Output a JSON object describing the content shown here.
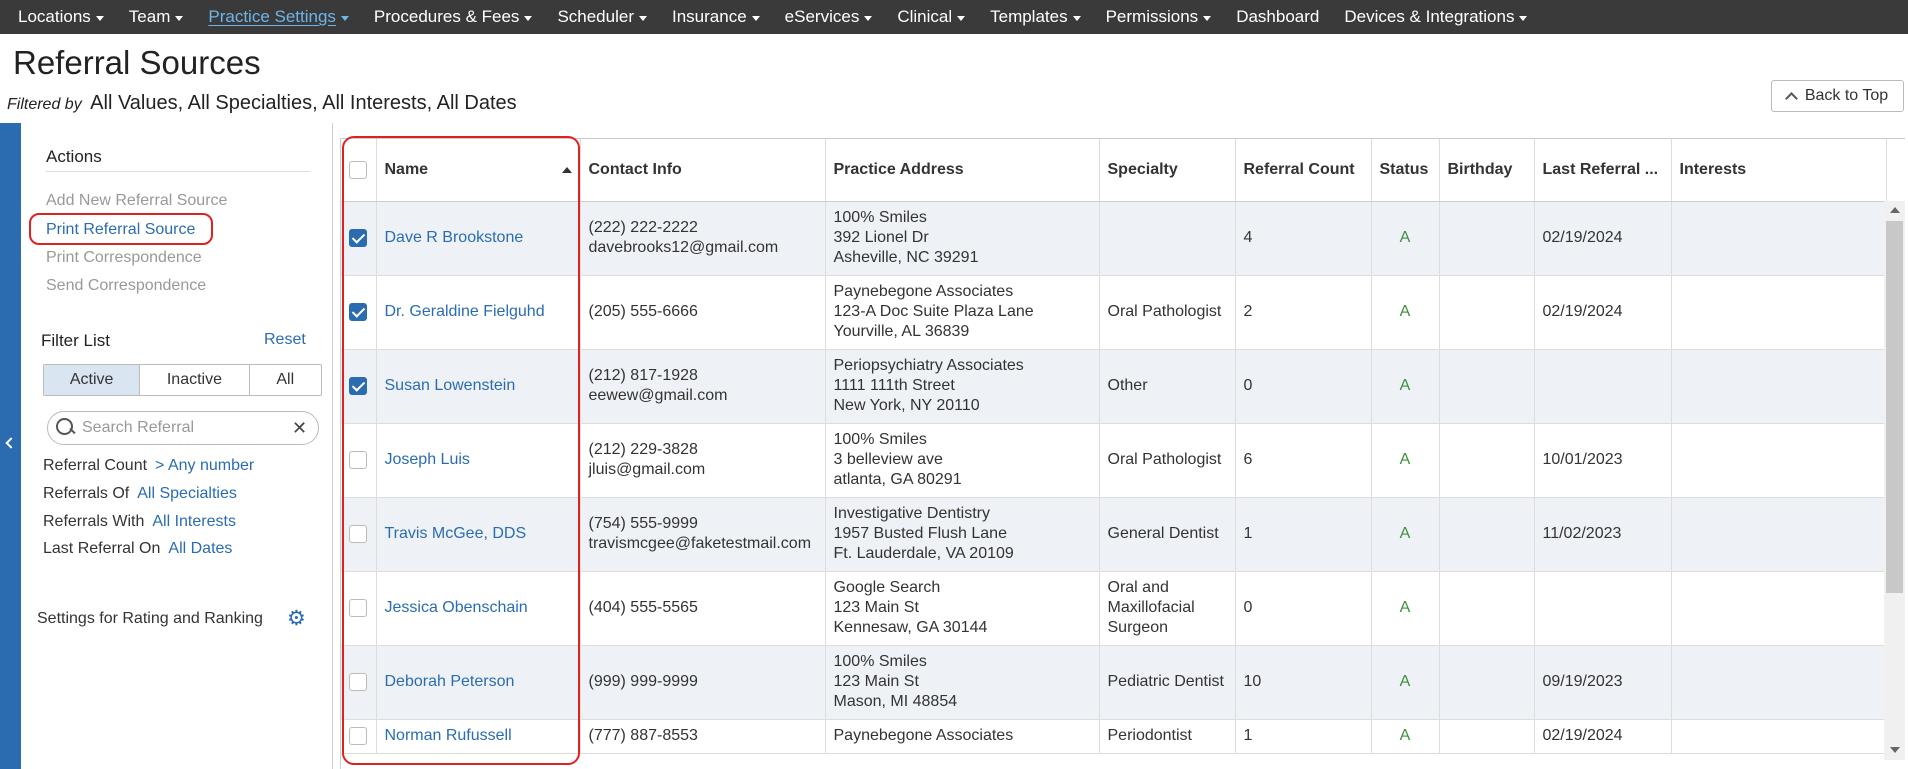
{
  "nav": {
    "items": [
      {
        "label": "Locations",
        "caret": true,
        "active": false
      },
      {
        "label": "Team",
        "caret": true,
        "active": false
      },
      {
        "label": "Practice Settings",
        "caret": true,
        "active": true
      },
      {
        "label": "Procedures & Fees",
        "caret": true,
        "active": false
      },
      {
        "label": "Scheduler",
        "caret": true,
        "active": false
      },
      {
        "label": "Insurance",
        "caret": true,
        "active": false
      },
      {
        "label": "eServices",
        "caret": true,
        "active": false
      },
      {
        "label": "Clinical",
        "caret": true,
        "active": false
      },
      {
        "label": "Templates",
        "caret": true,
        "active": false
      },
      {
        "label": "Permissions",
        "caret": true,
        "active": false
      },
      {
        "label": "Dashboard",
        "caret": false,
        "active": false
      },
      {
        "label": "Devices & Integrations",
        "caret": true,
        "active": false
      }
    ]
  },
  "header": {
    "title": "Referral Sources",
    "filtered_by_label": "Filtered by",
    "filtered_values": "All Values, All Specialties, All Interests, All Dates",
    "back_to_top": "Back to Top"
  },
  "sidebar": {
    "actions_title": "Actions",
    "actions": [
      {
        "label": "Add New Referral Source",
        "enabled": false
      },
      {
        "label": "Print Referral Source",
        "enabled": true
      },
      {
        "label": "Print Correspondence",
        "enabled": false
      },
      {
        "label": "Send Correspondence",
        "enabled": false
      }
    ],
    "filter_title": "Filter List",
    "reset": "Reset",
    "segments": [
      "Active",
      "Inactive",
      "All"
    ],
    "selected_segment": "Active",
    "search_placeholder": "Search Referral",
    "filters": [
      {
        "label": "Referral Count",
        "value": "> Any number"
      },
      {
        "label": "Referrals Of",
        "value": "All Specialties"
      },
      {
        "label": "Referrals With",
        "value": "All Interests"
      },
      {
        "label": "Last Referral On",
        "value": "All Dates"
      }
    ],
    "settings_label": "Settings for Rating and Ranking"
  },
  "table": {
    "columns": [
      "Name",
      "Contact Info",
      "Practice Address",
      "Specialty",
      "Referral Count",
      "Status",
      "Birthday",
      "Last Referral ...",
      "Interests"
    ],
    "rows": [
      {
        "checked": true,
        "name": "Dave R Brookstone",
        "contact": [
          "(222) 222-2222",
          "davebrooks12@gmail.com"
        ],
        "address": [
          "100% Smiles",
          "392 Lionel Dr",
          "Asheville, NC 39291"
        ],
        "specialty": [
          ""
        ],
        "count": "4",
        "status": "A",
        "birthday": "",
        "last_referral": "02/19/2024",
        "interests": ""
      },
      {
        "checked": true,
        "name": "Dr. Geraldine Fielguhd",
        "contact": [
          "(205) 555-6666"
        ],
        "address": [
          "Paynebegone Associates",
          "123-A Doc Suite Plaza Lane",
          "Yourville, AL 36839"
        ],
        "specialty": [
          "Oral Pathologist"
        ],
        "count": "2",
        "status": "A",
        "birthday": "",
        "last_referral": "02/19/2024",
        "interests": ""
      },
      {
        "checked": true,
        "name": "Susan Lowenstein",
        "contact": [
          "(212) 817-1928",
          "eewew@gmail.com"
        ],
        "address": [
          "Periopsychiatry Associates",
          "1111 111th Street",
          "New York, NY 20110"
        ],
        "specialty": [
          "Other"
        ],
        "count": "0",
        "status": "A",
        "birthday": "",
        "last_referral": "",
        "interests": ""
      },
      {
        "checked": false,
        "name": "Joseph Luis",
        "contact": [
          "(212) 229-3828",
          "jluis@gmail.com"
        ],
        "address": [
          "100% Smiles",
          "3 belleview ave",
          "atlanta, GA 80291"
        ],
        "specialty": [
          "Oral Pathologist"
        ],
        "count": "6",
        "status": "A",
        "birthday": "",
        "last_referral": "10/01/2023",
        "interests": ""
      },
      {
        "checked": false,
        "name": "Travis McGee, DDS",
        "contact": [
          "(754) 555-9999",
          "travismcgee@faketestmail.com"
        ],
        "address": [
          "Investigative Dentistry",
          "1957 Busted Flush Lane",
          "Ft. Lauderdale, VA 20109"
        ],
        "specialty": [
          "General Dentist"
        ],
        "count": "1",
        "status": "A",
        "birthday": "",
        "last_referral": "11/02/2023",
        "interests": ""
      },
      {
        "checked": false,
        "name": "Jessica Obenschain",
        "contact": [
          "(404) 555-5565"
        ],
        "address": [
          "Google Search",
          "123 Main St",
          "Kennesaw, GA 30144"
        ],
        "specialty": [
          "Oral and",
          "Maxillofacial",
          "Surgeon"
        ],
        "count": "0",
        "status": "A",
        "birthday": "",
        "last_referral": "",
        "interests": ""
      },
      {
        "checked": false,
        "name": "Deborah Peterson",
        "contact": [
          "(999) 999-9999"
        ],
        "address": [
          "100% Smiles",
          "123 Main St",
          "Mason, MI 48854"
        ],
        "specialty": [
          "Pediatric Dentist"
        ],
        "count": "10",
        "status": "A",
        "birthday": "",
        "last_referral": "09/19/2023",
        "interests": ""
      },
      {
        "checked": false,
        "name": "Norman Rufussell",
        "contact": [
          "(777) 887-8553"
        ],
        "address": [
          "Paynebegone Associates"
        ],
        "specialty": [
          "Periodontist"
        ],
        "count": "1",
        "status": "A",
        "birthday": "",
        "last_referral": "02/19/2024",
        "interests": ""
      }
    ]
  }
}
